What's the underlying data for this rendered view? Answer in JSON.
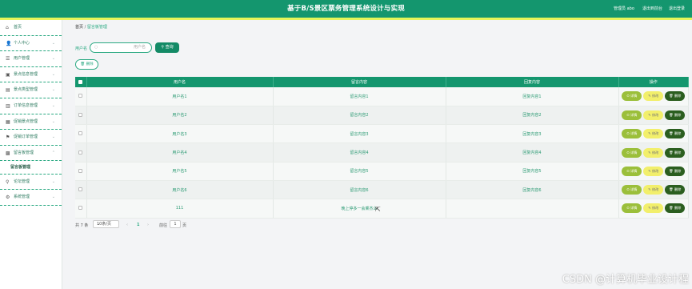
{
  "header": {
    "title": "基于B/S景区票务管理系统设计与实现",
    "user_label": "管理员 abo",
    "back_front": "退出到前台",
    "logout": "退出登录"
  },
  "sidebar": {
    "items": [
      {
        "label": "首页",
        "icon": "home-icon"
      },
      {
        "label": "个人中心",
        "icon": "user-icon"
      },
      {
        "label": "用户管理",
        "icon": "users-icon"
      },
      {
        "label": "景点信息管理",
        "icon": "scenic-icon"
      },
      {
        "label": "景点类型管理",
        "icon": "category-icon"
      },
      {
        "label": "订单信息管理",
        "icon": "order-icon"
      },
      {
        "label": "促销景点管理",
        "icon": "promo-icon"
      },
      {
        "label": "促销订单管理",
        "icon": "flag-icon"
      },
      {
        "label": "留言板管理",
        "icon": "message-icon"
      }
    ],
    "sub_item": "留言板管理",
    "items_after": [
      {
        "label": "论坛管理",
        "icon": "forum-icon"
      },
      {
        "label": "系统管理",
        "icon": "system-icon"
      }
    ]
  },
  "breadcrumb": {
    "home": "首页",
    "sep": "/",
    "current": "留言板管理"
  },
  "search": {
    "label": "用户名",
    "placeholder": "用户名",
    "button": "查询"
  },
  "batch_delete": "删除",
  "table": {
    "columns": [
      "用户名",
      "留言内容",
      "回复内容",
      "操作"
    ],
    "rows": [
      {
        "user": "用户名1",
        "content": "留言内容1",
        "reply": "回复内容1"
      },
      {
        "user": "用户名2",
        "content": "留言内容2",
        "reply": "回复内容2"
      },
      {
        "user": "用户名3",
        "content": "留言内容3",
        "reply": "回复内容3"
      },
      {
        "user": "用户名4",
        "content": "留言内容4",
        "reply": "回复内容4"
      },
      {
        "user": "用户名5",
        "content": "留言内容5",
        "reply": "回复内容5"
      },
      {
        "user": "用户名6",
        "content": "留言内容6",
        "reply": "回复内容6"
      },
      {
        "user": "111",
        "content": "晚上停多一会乘杰么",
        "reply": ""
      }
    ],
    "actions": {
      "detail": "详情",
      "edit": "修改",
      "delete": "删除"
    }
  },
  "pagination": {
    "total": "共 7 条",
    "page_size": "10条/页",
    "prev": "‹",
    "current": "1",
    "next": "›",
    "goto": "前往",
    "page_input": "1",
    "page_unit": "页"
  },
  "watermark": "CSDN @计算机毕业设计程"
}
